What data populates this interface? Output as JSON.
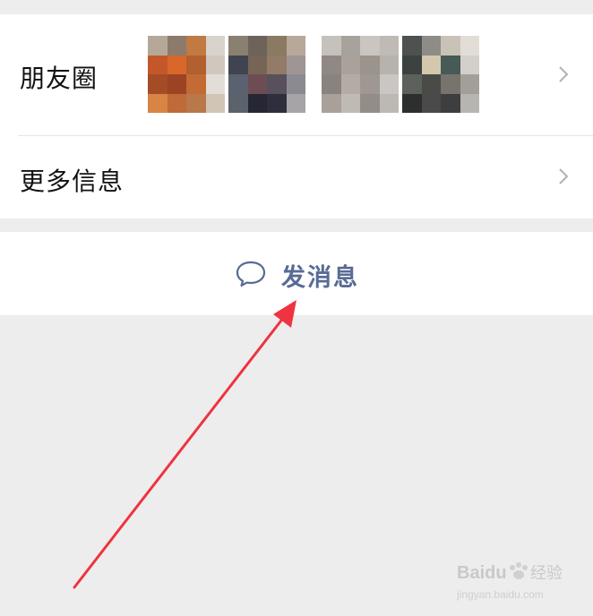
{
  "profile": {
    "rows": {
      "moments": {
        "label": "朋友圈",
        "thumbnail_count": 4
      },
      "more_info": {
        "label": "更多信息"
      }
    },
    "actions": {
      "send_message": {
        "label": "发消息",
        "icon": "chat-bubble-icon"
      }
    }
  },
  "icons": {
    "row_chevron": "chevron-right-icon",
    "annotation": "red-arrow-annotation"
  },
  "watermark": {
    "brand": "Baidu",
    "label": "经验",
    "url": "jingyan.baidu.com"
  },
  "colors": {
    "background": "#ededed",
    "card": "#ffffff",
    "text": "#111111",
    "link": "#576b95",
    "chevron": "#b2b2b2",
    "annotation": "#ef3340"
  }
}
